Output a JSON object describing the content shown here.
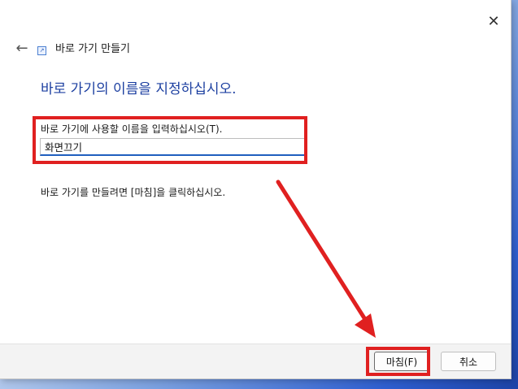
{
  "wizard": {
    "title": "바로 가기 만들기",
    "back_icon": "back-arrow-icon",
    "close_icon": "close-icon",
    "heading": "바로 가기의 이름을 지정하십시오.",
    "name_label": "바로 가기에 사용할 이름을 입력하십시오(T).",
    "name_value": "화면끄기",
    "instruction": "바로 가기를 만들려면 [마침]을 클릭하십시오.",
    "finish_label": "마침(F)",
    "cancel_label": "취소"
  },
  "annotation": {
    "color": "#e02020"
  }
}
